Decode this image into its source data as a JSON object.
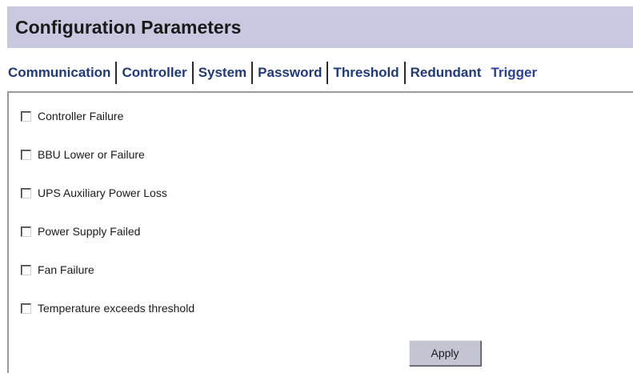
{
  "header": {
    "title": "Configuration Parameters"
  },
  "tabs": [
    {
      "label": "Communication"
    },
    {
      "label": "Controller"
    },
    {
      "label": "System"
    },
    {
      "label": "Password"
    },
    {
      "label": "Threshold"
    },
    {
      "label": "Redundant"
    },
    {
      "label": "Trigger",
      "active": true
    }
  ],
  "triggers": [
    {
      "label": "Controller Failure",
      "checked": false
    },
    {
      "label": "BBU Lower or Failure",
      "checked": false
    },
    {
      "label": "UPS Auxiliary Power Loss",
      "checked": false
    },
    {
      "label": "Power Supply Failed",
      "checked": false
    },
    {
      "label": "Fan Failure",
      "checked": false
    },
    {
      "label": "Temperature exceeds threshold",
      "checked": false
    }
  ],
  "actions": {
    "apply_label": "Apply"
  },
  "colors": {
    "title_bar_bg": "#c8c9e0",
    "tab_text": "#1f3a7a",
    "button_bg": "#c4c5d3"
  }
}
